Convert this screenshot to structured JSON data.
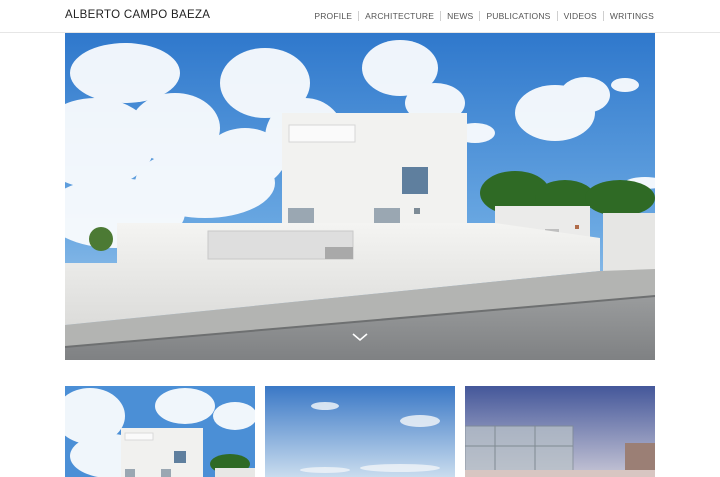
{
  "site": {
    "title": "ALBERTO CAMPO BAEZA"
  },
  "nav": {
    "items": [
      {
        "label": "PROFILE"
      },
      {
        "label": "ARCHITECTURE"
      },
      {
        "label": "NEWS"
      },
      {
        "label": "PUBLICATIONS"
      },
      {
        "label": "VIDEOS"
      },
      {
        "label": "WRITINGS"
      }
    ]
  },
  "hero": {
    "icon": "chevron-down-icon"
  },
  "colors": {
    "sky": "#3f86d2",
    "wall": "#ececea",
    "road": "#8d8f90"
  }
}
